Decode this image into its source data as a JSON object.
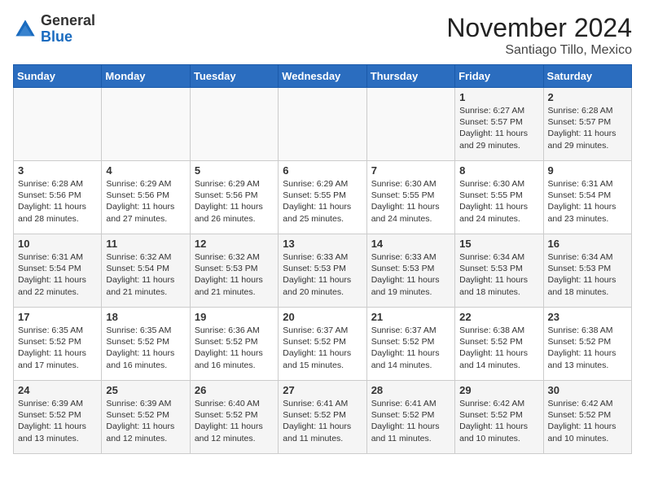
{
  "logo": {
    "general": "General",
    "blue": "Blue"
  },
  "header": {
    "month": "November 2024",
    "location": "Santiago Tillo, Mexico"
  },
  "weekdays": [
    "Sunday",
    "Monday",
    "Tuesday",
    "Wednesday",
    "Thursday",
    "Friday",
    "Saturday"
  ],
  "weeks": [
    [
      {
        "day": "",
        "sunrise": "",
        "sunset": "",
        "daylight": ""
      },
      {
        "day": "",
        "sunrise": "",
        "sunset": "",
        "daylight": ""
      },
      {
        "day": "",
        "sunrise": "",
        "sunset": "",
        "daylight": ""
      },
      {
        "day": "",
        "sunrise": "",
        "sunset": "",
        "daylight": ""
      },
      {
        "day": "",
        "sunrise": "",
        "sunset": "",
        "daylight": ""
      },
      {
        "day": "1",
        "sunrise": "Sunrise: 6:27 AM",
        "sunset": "Sunset: 5:57 PM",
        "daylight": "Daylight: 11 hours and 29 minutes."
      },
      {
        "day": "2",
        "sunrise": "Sunrise: 6:28 AM",
        "sunset": "Sunset: 5:57 PM",
        "daylight": "Daylight: 11 hours and 29 minutes."
      }
    ],
    [
      {
        "day": "3",
        "sunrise": "Sunrise: 6:28 AM",
        "sunset": "Sunset: 5:56 PM",
        "daylight": "Daylight: 11 hours and 28 minutes."
      },
      {
        "day": "4",
        "sunrise": "Sunrise: 6:29 AM",
        "sunset": "Sunset: 5:56 PM",
        "daylight": "Daylight: 11 hours and 27 minutes."
      },
      {
        "day": "5",
        "sunrise": "Sunrise: 6:29 AM",
        "sunset": "Sunset: 5:56 PM",
        "daylight": "Daylight: 11 hours and 26 minutes."
      },
      {
        "day": "6",
        "sunrise": "Sunrise: 6:29 AM",
        "sunset": "Sunset: 5:55 PM",
        "daylight": "Daylight: 11 hours and 25 minutes."
      },
      {
        "day": "7",
        "sunrise": "Sunrise: 6:30 AM",
        "sunset": "Sunset: 5:55 PM",
        "daylight": "Daylight: 11 hours and 24 minutes."
      },
      {
        "day": "8",
        "sunrise": "Sunrise: 6:30 AM",
        "sunset": "Sunset: 5:55 PM",
        "daylight": "Daylight: 11 hours and 24 minutes."
      },
      {
        "day": "9",
        "sunrise": "Sunrise: 6:31 AM",
        "sunset": "Sunset: 5:54 PM",
        "daylight": "Daylight: 11 hours and 23 minutes."
      }
    ],
    [
      {
        "day": "10",
        "sunrise": "Sunrise: 6:31 AM",
        "sunset": "Sunset: 5:54 PM",
        "daylight": "Daylight: 11 hours and 22 minutes."
      },
      {
        "day": "11",
        "sunrise": "Sunrise: 6:32 AM",
        "sunset": "Sunset: 5:54 PM",
        "daylight": "Daylight: 11 hours and 21 minutes."
      },
      {
        "day": "12",
        "sunrise": "Sunrise: 6:32 AM",
        "sunset": "Sunset: 5:53 PM",
        "daylight": "Daylight: 11 hours and 21 minutes."
      },
      {
        "day": "13",
        "sunrise": "Sunrise: 6:33 AM",
        "sunset": "Sunset: 5:53 PM",
        "daylight": "Daylight: 11 hours and 20 minutes."
      },
      {
        "day": "14",
        "sunrise": "Sunrise: 6:33 AM",
        "sunset": "Sunset: 5:53 PM",
        "daylight": "Daylight: 11 hours and 19 minutes."
      },
      {
        "day": "15",
        "sunrise": "Sunrise: 6:34 AM",
        "sunset": "Sunset: 5:53 PM",
        "daylight": "Daylight: 11 hours and 18 minutes."
      },
      {
        "day": "16",
        "sunrise": "Sunrise: 6:34 AM",
        "sunset": "Sunset: 5:53 PM",
        "daylight": "Daylight: 11 hours and 18 minutes."
      }
    ],
    [
      {
        "day": "17",
        "sunrise": "Sunrise: 6:35 AM",
        "sunset": "Sunset: 5:52 PM",
        "daylight": "Daylight: 11 hours and 17 minutes."
      },
      {
        "day": "18",
        "sunrise": "Sunrise: 6:35 AM",
        "sunset": "Sunset: 5:52 PM",
        "daylight": "Daylight: 11 hours and 16 minutes."
      },
      {
        "day": "19",
        "sunrise": "Sunrise: 6:36 AM",
        "sunset": "Sunset: 5:52 PM",
        "daylight": "Daylight: 11 hours and 16 minutes."
      },
      {
        "day": "20",
        "sunrise": "Sunrise: 6:37 AM",
        "sunset": "Sunset: 5:52 PM",
        "daylight": "Daylight: 11 hours and 15 minutes."
      },
      {
        "day": "21",
        "sunrise": "Sunrise: 6:37 AM",
        "sunset": "Sunset: 5:52 PM",
        "daylight": "Daylight: 11 hours and 14 minutes."
      },
      {
        "day": "22",
        "sunrise": "Sunrise: 6:38 AM",
        "sunset": "Sunset: 5:52 PM",
        "daylight": "Daylight: 11 hours and 14 minutes."
      },
      {
        "day": "23",
        "sunrise": "Sunrise: 6:38 AM",
        "sunset": "Sunset: 5:52 PM",
        "daylight": "Daylight: 11 hours and 13 minutes."
      }
    ],
    [
      {
        "day": "24",
        "sunrise": "Sunrise: 6:39 AM",
        "sunset": "Sunset: 5:52 PM",
        "daylight": "Daylight: 11 hours and 13 minutes."
      },
      {
        "day": "25",
        "sunrise": "Sunrise: 6:39 AM",
        "sunset": "Sunset: 5:52 PM",
        "daylight": "Daylight: 11 hours and 12 minutes."
      },
      {
        "day": "26",
        "sunrise": "Sunrise: 6:40 AM",
        "sunset": "Sunset: 5:52 PM",
        "daylight": "Daylight: 11 hours and 12 minutes."
      },
      {
        "day": "27",
        "sunrise": "Sunrise: 6:41 AM",
        "sunset": "Sunset: 5:52 PM",
        "daylight": "Daylight: 11 hours and 11 minutes."
      },
      {
        "day": "28",
        "sunrise": "Sunrise: 6:41 AM",
        "sunset": "Sunset: 5:52 PM",
        "daylight": "Daylight: 11 hours and 11 minutes."
      },
      {
        "day": "29",
        "sunrise": "Sunrise: 6:42 AM",
        "sunset": "Sunset: 5:52 PM",
        "daylight": "Daylight: 11 hours and 10 minutes."
      },
      {
        "day": "30",
        "sunrise": "Sunrise: 6:42 AM",
        "sunset": "Sunset: 5:52 PM",
        "daylight": "Daylight: 11 hours and 10 minutes."
      }
    ]
  ]
}
